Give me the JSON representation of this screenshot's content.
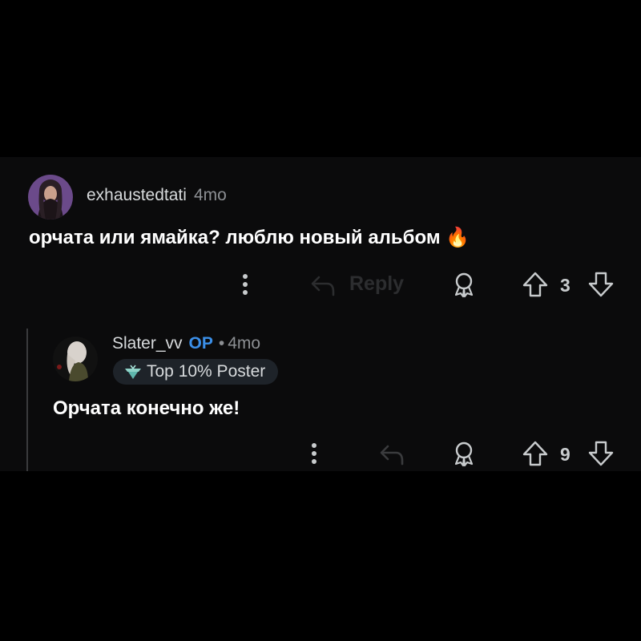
{
  "comments": [
    {
      "username": "exhaustedtati",
      "time": "4mo",
      "text": "орчата или ямайка? люблю новый альбом 🔥",
      "actions": {
        "reply_label": "Reply",
        "votes": "3"
      },
      "avatar_icon": "user-avatar"
    },
    {
      "username": "Slater_vv",
      "op_label": "OP",
      "separator": "•",
      "time": "4mo",
      "badge": "Top 10% Poster",
      "text": "Орчата конечно же!",
      "actions": {
        "votes": "9"
      },
      "avatar_icon": "user-avatar"
    }
  ],
  "colors": {
    "background": "#000000",
    "panel": "#0b0b0c",
    "op_blue": "#3b8fe8",
    "muted": "#8c8f93",
    "badge_bg": "#1e2329"
  }
}
